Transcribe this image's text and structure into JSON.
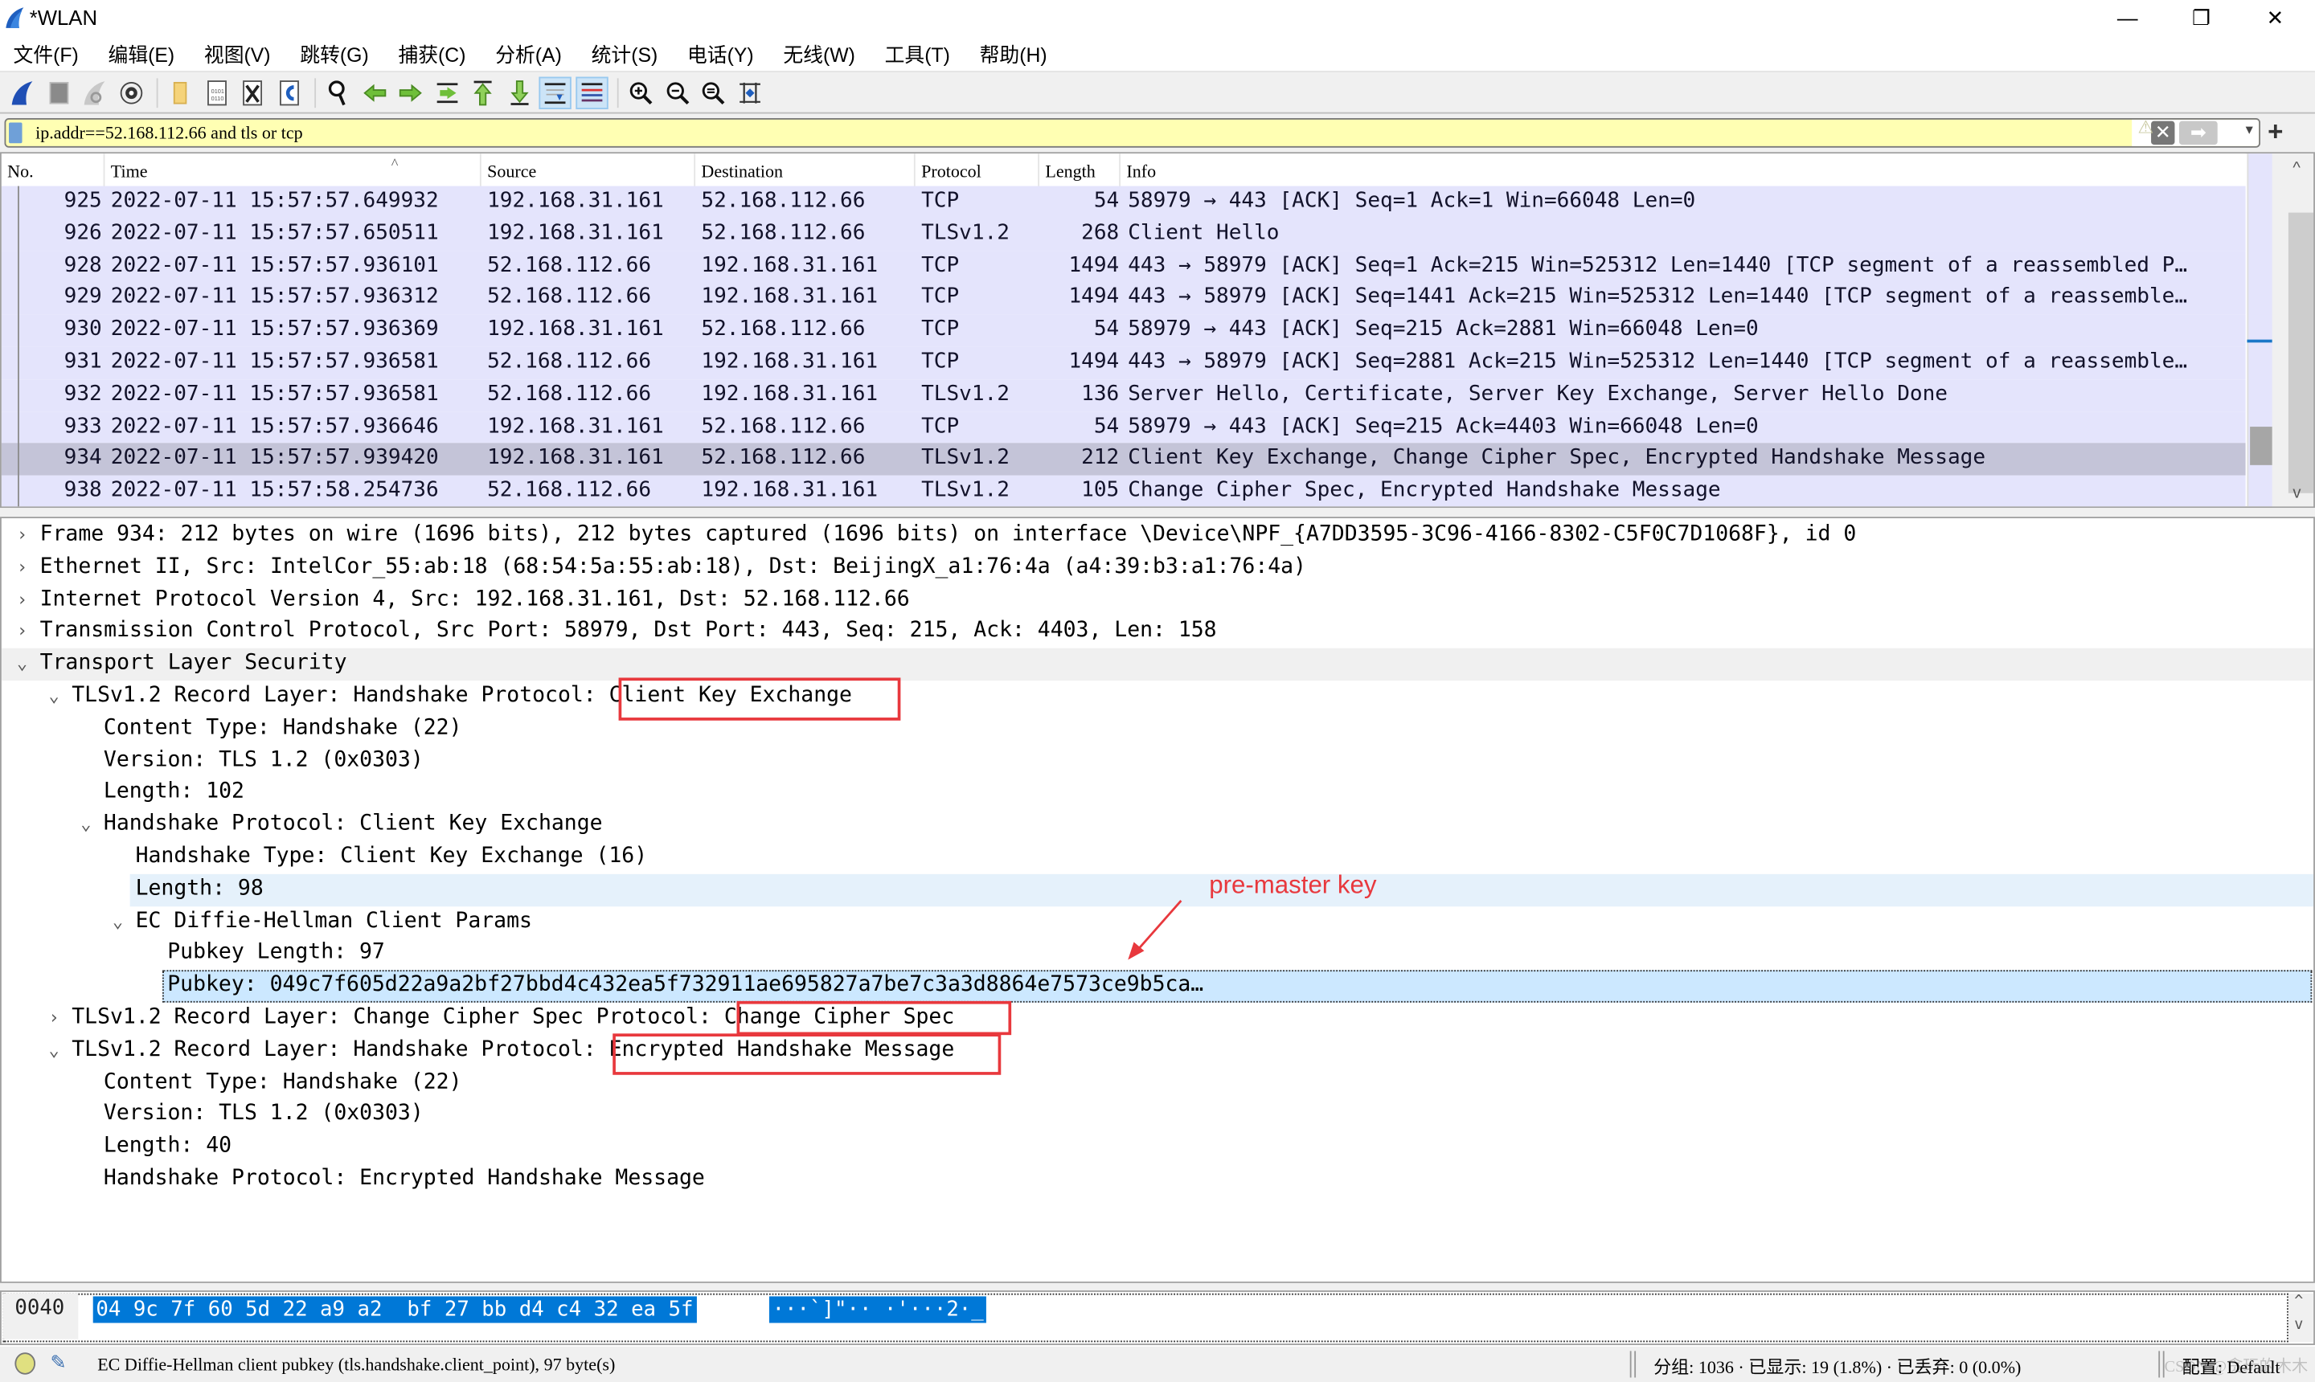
{
  "window": {
    "title": "*WLAN",
    "minimize": "—",
    "restore": "❐",
    "close": "✕"
  },
  "menu": [
    "文件(F)",
    "编辑(E)",
    "视图(V)",
    "跳转(G)",
    "捕获(C)",
    "分析(A)",
    "统计(S)",
    "电话(Y)",
    "无线(W)",
    "工具(T)",
    "帮助(H)"
  ],
  "toolbar": {
    "buttons": [
      {
        "icon": "shark-fin-start-capture-icon"
      },
      {
        "icon": "stop-capture-icon"
      },
      {
        "icon": "restart-capture-icon"
      },
      {
        "icon": "capture-options-icon"
      },
      {
        "icon": "open-file-icon"
      },
      {
        "icon": "save-file-icon"
      },
      {
        "icon": "close-file-icon"
      },
      {
        "icon": "reload-file-icon"
      },
      {
        "icon": "find-packet-icon"
      },
      {
        "icon": "go-back-icon"
      },
      {
        "icon": "go-forward-icon"
      },
      {
        "icon": "go-to-packet-icon"
      },
      {
        "icon": "go-first-packet-icon"
      },
      {
        "icon": "go-last-packet-icon"
      },
      {
        "icon": "auto-scroll-icon",
        "active": true
      },
      {
        "icon": "colorize-icon",
        "active": true
      },
      {
        "icon": "zoom-in-icon"
      },
      {
        "icon": "zoom-out-icon"
      },
      {
        "icon": "zoom-normal-icon"
      },
      {
        "icon": "resize-columns-icon"
      }
    ]
  },
  "filter": {
    "value": "ip.addr==52.168.112.66 and tls or tcp",
    "warn_icon": "⚠",
    "clear_icon": "✕",
    "apply_icon": "➡",
    "dropdown_icon": "▾",
    "add_icon": "+"
  },
  "packet_list": {
    "columns": [
      "No.",
      "Time",
      "Source",
      "Destination",
      "Protocol",
      "Length",
      "Info"
    ],
    "sort_indicator": "^",
    "rows": [
      {
        "no": "925",
        "time": "2022-07-11 15:57:57.649932",
        "src": "192.168.31.161",
        "dst": "52.168.112.66",
        "proto": "TCP",
        "len": "54",
        "info": "58979 → 443 [ACK] Seq=1 Ack=1 Win=66048 Len=0"
      },
      {
        "no": "926",
        "time": "2022-07-11 15:57:57.650511",
        "src": "192.168.31.161",
        "dst": "52.168.112.66",
        "proto": "TLSv1.2",
        "len": "268",
        "info": "Client Hello"
      },
      {
        "no": "928",
        "time": "2022-07-11 15:57:57.936101",
        "src": "52.168.112.66",
        "dst": "192.168.31.161",
        "proto": "TCP",
        "len": "1494",
        "info": "443 → 58979 [ACK] Seq=1 Ack=215 Win=525312 Len=1440 [TCP segment of a reassembled P…"
      },
      {
        "no": "929",
        "time": "2022-07-11 15:57:57.936312",
        "src": "52.168.112.66",
        "dst": "192.168.31.161",
        "proto": "TCP",
        "len": "1494",
        "info": "443 → 58979 [ACK] Seq=1441 Ack=215 Win=525312 Len=1440 [TCP segment of a reassemble…"
      },
      {
        "no": "930",
        "time": "2022-07-11 15:57:57.936369",
        "src": "192.168.31.161",
        "dst": "52.168.112.66",
        "proto": "TCP",
        "len": "54",
        "info": "58979 → 443 [ACK] Seq=215 Ack=2881 Win=66048 Len=0"
      },
      {
        "no": "931",
        "time": "2022-07-11 15:57:57.936581",
        "src": "52.168.112.66",
        "dst": "192.168.31.161",
        "proto": "TCP",
        "len": "1494",
        "info": "443 → 58979 [ACK] Seq=2881 Ack=215 Win=525312 Len=1440 [TCP segment of a reassemble…"
      },
      {
        "no": "932",
        "time": "2022-07-11 15:57:57.936581",
        "src": "52.168.112.66",
        "dst": "192.168.31.161",
        "proto": "TLSv1.2",
        "len": "136",
        "info": "Server Hello, Certificate, Server Key Exchange, Server Hello Done"
      },
      {
        "no": "933",
        "time": "2022-07-11 15:57:57.936646",
        "src": "192.168.31.161",
        "dst": "52.168.112.66",
        "proto": "TCP",
        "len": "54",
        "info": "58979 → 443 [ACK] Seq=215 Ack=4403 Win=66048 Len=0"
      },
      {
        "no": "934",
        "time": "2022-07-11 15:57:57.939420",
        "src": "192.168.31.161",
        "dst": "52.168.112.66",
        "proto": "TLSv1.2",
        "len": "212",
        "info": "Client Key Exchange, Change Cipher Spec, Encrypted Handshake Message",
        "selected": true
      },
      {
        "no": "938",
        "time": "2022-07-11 15:57:58.254736",
        "src": "52.168.112.66",
        "dst": "192.168.31.161",
        "proto": "TLSv1.2",
        "len": "105",
        "info": "Change Cipher Spec, Encrypted Handshake Message"
      }
    ],
    "scroll_up": "^",
    "scroll_down": "v"
  },
  "details": {
    "rows": [
      {
        "level": 0,
        "toggle": "›",
        "text": "Frame 934: 212 bytes on wire (1696 bits), 212 bytes captured (1696 bits) on interface \\Device\\NPF_{A7DD3595-3C96-4166-8302-C5F0C7D1068F}, id 0"
      },
      {
        "level": 0,
        "toggle": "›",
        "text": "Ethernet II, Src: IntelCor_55:ab:18 (68:54:5a:55:ab:18), Dst: BeijingX_a1:76:4a (a4:39:b3:a1:76:4a)"
      },
      {
        "level": 0,
        "toggle": "›",
        "text": "Internet Protocol Version 4, Src: 192.168.31.161, Dst: 52.168.112.66"
      },
      {
        "level": 0,
        "toggle": "›",
        "text": "Transmission Control Protocol, Src Port: 58979, Dst Port: 443, Seq: 215, Ack: 4403, Len: 158"
      },
      {
        "level": 0,
        "toggle": "⌄",
        "text": "Transport Layer Security",
        "highlight": true
      },
      {
        "level": 1,
        "toggle": "⌄",
        "text": "TLSv1.2 Record Layer: Handshake Protocol: Client Key Exchange"
      },
      {
        "level": 2,
        "toggle": "",
        "text": "Content Type: Handshake (22)"
      },
      {
        "level": 2,
        "toggle": "",
        "text": "Version: TLS 1.2 (0x0303)"
      },
      {
        "level": 2,
        "toggle": "",
        "text": "Length: 102"
      },
      {
        "level": 2,
        "toggle": "⌄",
        "text": "Handshake Protocol: Client Key Exchange"
      },
      {
        "level": 3,
        "toggle": "",
        "text": "Handshake Type: Client Key Exchange (16)"
      },
      {
        "level": 3,
        "toggle": "",
        "text": "Length: 98",
        "related": true
      },
      {
        "level": 3,
        "toggle": "⌄",
        "text": "EC Diffie-Hellman Client Params"
      },
      {
        "level": 4,
        "toggle": "",
        "text": "Pubkey Length: 97"
      },
      {
        "level": 4,
        "toggle": "",
        "text": "Pubkey: 049c7f605d22a9a2bf27bbd4c432ea5f732911ae695827a7be7c3a3d8864e7573ce9b5ca…",
        "selected": true
      },
      {
        "level": 1,
        "toggle": "›",
        "text": "TLSv1.2 Record Layer: Change Cipher Spec Protocol: Change Cipher Spec"
      },
      {
        "level": 1,
        "toggle": "⌄",
        "text": "TLSv1.2 Record Layer: Handshake Protocol: Encrypted Handshake Message"
      },
      {
        "level": 2,
        "toggle": "",
        "text": "Content Type: Handshake (22)"
      },
      {
        "level": 2,
        "toggle": "",
        "text": "Version: TLS 1.2 (0x0303)"
      },
      {
        "level": 2,
        "toggle": "",
        "text": "Length: 40"
      },
      {
        "level": 2,
        "toggle": "",
        "text": "Handshake Protocol: Encrypted Handshake Message"
      }
    ],
    "annotation": {
      "text": "pre-master key",
      "color": "#e8383d"
    }
  },
  "bytes": {
    "offset": "0040",
    "hex": "04 9c 7f 60 5d 22 a9 a2  bf 27 bb d4 c4 32 ea 5f",
    "ascii": "···`]\"·· ·'···2·_",
    "scroll_up": "^",
    "scroll_down": "v"
  },
  "status": {
    "field_info": "EC Diffie-Hellman client pubkey (tls.handshake.client_point), 97 byte(s)",
    "stats": "分组: 1036 · 已显示: 19 (1.8%) · 已丢弃: 0 (0.0%)",
    "profile": "配置: Default",
    "watermark": "CSDN @贪玩的木木"
  },
  "colors": {
    "packet_row_bg": "#e4e4fc",
    "packet_row_selected_bg": "#c4c4d8",
    "filter_bg": "#ffffb3",
    "annotation_red": "#e8383d",
    "bytes_selected_bg": "#0078d7"
  }
}
